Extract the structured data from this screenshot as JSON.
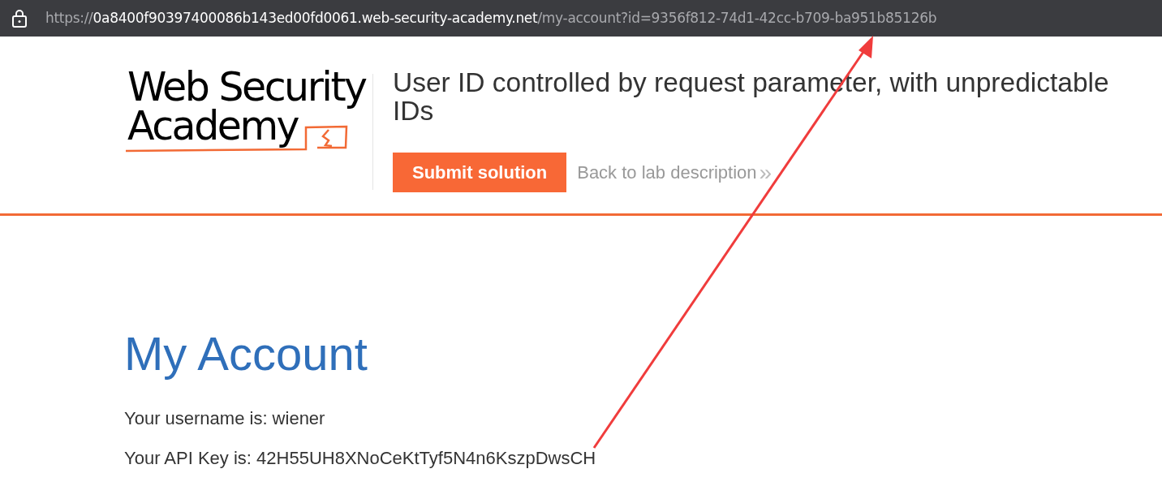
{
  "address_bar": {
    "scheme": "https://",
    "host": "0a8400f90397400086b143ed00fd0061.web-security-academy.net",
    "path": "/my-account?id=9356f812-74d1-42cc-b709-ba951b85126b"
  },
  "logo": {
    "line_1": "Web Security",
    "line_2": "Academy"
  },
  "lab_title": "User ID controlled by request parameter, with unpredictable IDs",
  "submit_button": "Submit solution",
  "back_link": "Back to lab description",
  "back_link_icon": "»",
  "heading": "My Account",
  "details": [
    "Your username is: wiener",
    "Your API Key is: 42H55UH8XNoCeKtTyf5N4n6KszpDwsCH"
  ],
  "annotation": {
    "kind": "arrow"
  }
}
